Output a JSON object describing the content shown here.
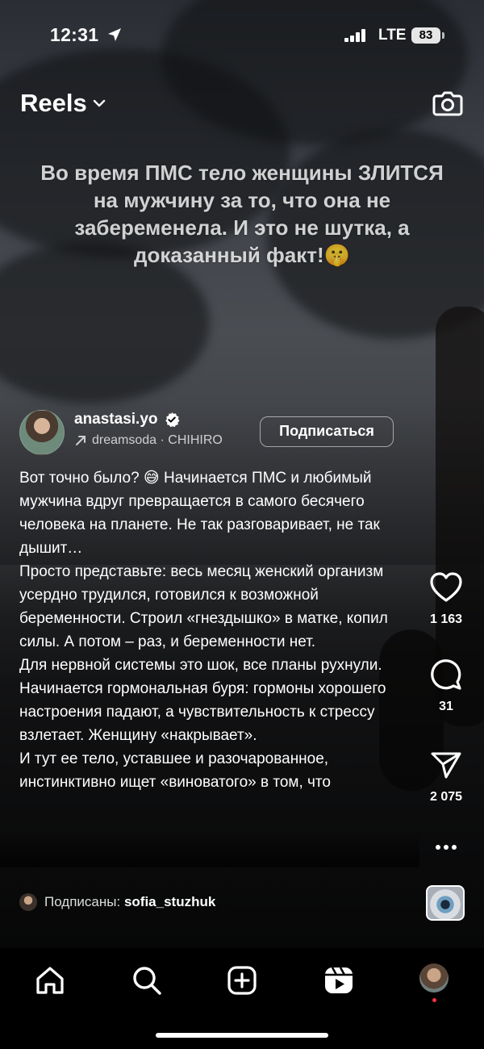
{
  "status_bar": {
    "time": "12:31",
    "network": "LTE",
    "battery": "83",
    "location_icon": "location-arrow-icon",
    "signal_icon": "cellular-signal-icon"
  },
  "header": {
    "title": "Reels",
    "dropdown_icon": "chevron-down-icon",
    "camera_icon": "camera-icon"
  },
  "video": {
    "overlay_text": "Во время ПМС тело женщины ЗЛИТСЯ на мужчину за то, что она не забеременела. И это не шутка, а доказанный факт!🤫"
  },
  "author": {
    "username": "anastasi.yo",
    "verified_icon": "verified-badge-icon",
    "audio": "dreamsoda · CHIHIRO",
    "follow_label": "Подписаться"
  },
  "description": {
    "paragraphs": [
      "Вот точно было? 😅 Начинается ПМС и любимый мужчина вдруг превращается в самого бесячего человека на планете. Не так разговаривает, не так дышит…",
      "",
      "Просто представьте: весь месяц женский организм усердно трудился, готовился к возможной беременности. Строил «гнездышко» в матке, копил силы. А потом – раз, и беременности нет.",
      "Для нервной системы это шок, все планы рухнули. Начинается гормональная буря: гормоны хорошего настроения падают, а чувствительность к стрессу взлетает. Женщину «накрывает».",
      "И тут ее тело, уставшее и разочарованное, инстинктивно ищет «виноватого» в том, что"
    ]
  },
  "followed_by": {
    "label": "Подписаны:",
    "name": "sofia_stuzhuk"
  },
  "actions": {
    "likes": "1 163",
    "comments": "31",
    "shares": "2 075",
    "like_icon": "heart-icon",
    "comment_icon": "comment-bubble-icon",
    "share_icon": "paper-plane-icon",
    "more_icon": "more-dots-icon"
  },
  "bottom_nav": {
    "items": [
      "home-icon",
      "search-icon",
      "create-plus-icon",
      "reels-icon",
      "profile-avatar"
    ]
  }
}
